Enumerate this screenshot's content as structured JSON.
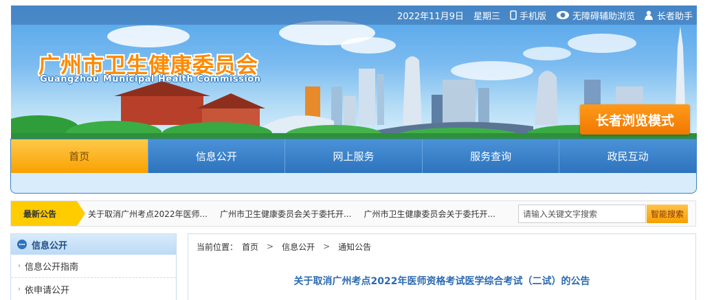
{
  "topbar": {
    "date": "2022年11月9日",
    "weekday": "星期三",
    "mobile": "手机版",
    "accessibility": "无障碍辅助浏览",
    "elder_helper": "长者助手"
  },
  "header": {
    "title": "广州市卫生健康委员会",
    "subtitle": "Guangzhou Municipal Health Commission",
    "elder_mode": "长者浏览模式"
  },
  "nav": {
    "items": [
      {
        "label": "首页"
      },
      {
        "label": "信息公开"
      },
      {
        "label": "网上服务"
      },
      {
        "label": "服务查询"
      },
      {
        "label": "政民互动"
      }
    ]
  },
  "notice": {
    "label": "最新公告",
    "items": [
      "关于取消广州考点2022年医师...",
      "广州市卫生健康委员会关于委托开...",
      "广州市卫生健康委员会关于委托开..."
    ]
  },
  "search": {
    "value": "请输入关键文字搜索",
    "button": "智能搜索"
  },
  "sidebar": {
    "title": "信息公开",
    "items": [
      {
        "label": "信息公开指南"
      },
      {
        "label": "依申请公开"
      }
    ]
  },
  "main": {
    "breadcrumb_label": "当前位置：",
    "breadcrumb": [
      "首页",
      "信息公开",
      "通知公告"
    ],
    "article_title": "关于取消广州考点2022年医师资格考试医学综合考试（二试）的公告"
  },
  "colors": {
    "accent_orange": "#f7941d",
    "nav_blue": "#2e73bd",
    "title_blue": "#2b6ab1"
  }
}
